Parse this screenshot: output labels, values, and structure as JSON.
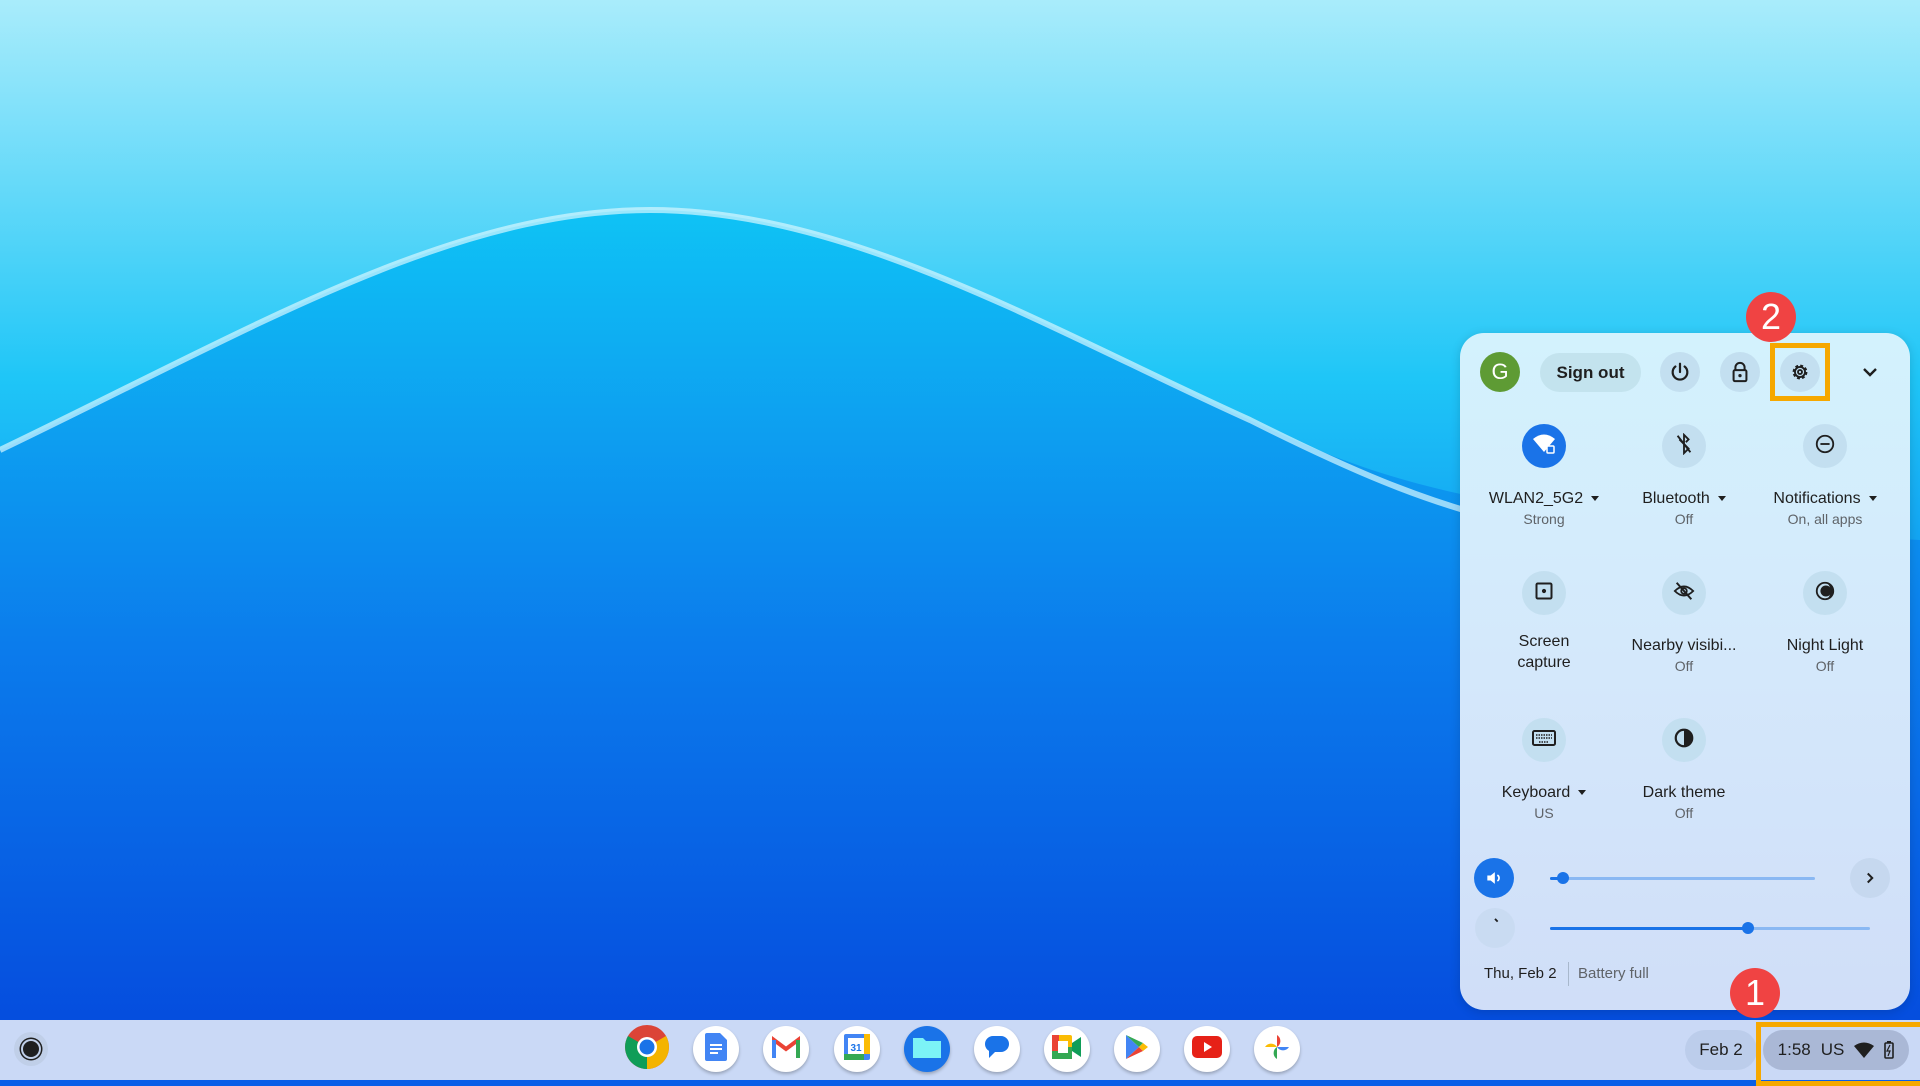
{
  "quick_settings": {
    "avatar_initial": "G",
    "sign_out_label": "Sign out",
    "header_icons": [
      "power-icon",
      "lock-icon",
      "gear-icon",
      "chevron-down-icon"
    ],
    "tiles": [
      {
        "label": "WLAN2_5G2",
        "sub": "Strong",
        "icon": "wifi-lock-icon",
        "active": true,
        "dropdown": true
      },
      {
        "label": "Bluetooth",
        "sub": "Off",
        "icon": "bluetooth-off-icon",
        "active": false,
        "dropdown": true
      },
      {
        "label": "Notifications",
        "sub": "On, all apps",
        "icon": "do-not-disturb-icon",
        "active": false,
        "dropdown": true
      },
      {
        "label": "Screen capture",
        "sub": "",
        "icon": "screen-capture-icon",
        "active": false,
        "dropdown": false
      },
      {
        "label": "Nearby visibi...",
        "sub": "Off",
        "icon": "visibility-off-icon",
        "active": false,
        "dropdown": false
      },
      {
        "label": "Night Light",
        "sub": "Off",
        "icon": "night-light-icon",
        "active": false,
        "dropdown": false
      },
      {
        "label": "Keyboard",
        "sub": "US",
        "icon": "keyboard-icon",
        "active": false,
        "dropdown": true
      },
      {
        "label": "Dark theme",
        "sub": "Off",
        "icon": "dark-theme-icon",
        "active": false,
        "dropdown": false
      }
    ],
    "volume_percent": 5,
    "brightness_percent": 62,
    "date": "Thu, Feb 2",
    "battery": "Battery full"
  },
  "shelf": {
    "apps": [
      "Chrome",
      "Docs",
      "Gmail",
      "Calendar",
      "Files",
      "Messages",
      "Meet",
      "Play Store",
      "YouTube",
      "Photos"
    ],
    "calendar_day": "31",
    "date_pill": "Feb 2",
    "time": "1:58",
    "ime": "US"
  },
  "annotations": {
    "step1": "1",
    "step2": "2",
    "highlight_color": "#f6a800",
    "badge_color": "#f04343"
  },
  "colors": {
    "accent": "#1a73e8"
  }
}
